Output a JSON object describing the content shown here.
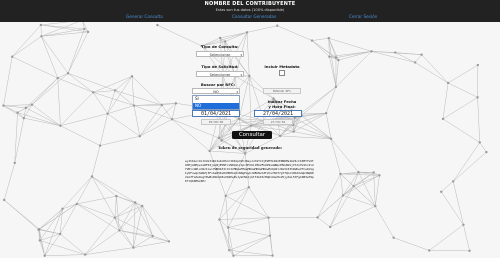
{
  "header": {
    "title": "NOMBRE DEL CONTRIBUYENTE",
    "subtitle": "Estas son tus datos (100% disponible)"
  },
  "nav": {
    "items": [
      {
        "label": "Generar Consulta"
      },
      {
        "label": "Consultar Generadas"
      },
      {
        "label": "Cerrar Sesión"
      }
    ]
  },
  "form": {
    "tipo_consulta": {
      "label": "Tipo de Consulta:",
      "value": "Seleccionar"
    },
    "tipo_solicitud": {
      "label": "Tipo de Solicitud:",
      "value": "Seleccionar"
    },
    "incluir_metadata": {
      "label": "Incluir Metadata"
    },
    "buscar_rfc": {
      "label": "Buscar por RFC:",
      "value": "NO",
      "options": [
        "SI",
        "NO"
      ]
    },
    "rfc_hint": "BUSCAR RFC",
    "fecha_inicial": {
      "value": "01/04/2021",
      "time": "00:00:00"
    },
    "fecha_final": {
      "label_line1": "Indicar Fecha",
      "label_line2": "y Hora Final:",
      "value": "27/04/2021",
      "time": "23:59:59"
    },
    "submit_label": "Consultar"
  },
  "token": {
    "title": "Token de seguridad generado:",
    "value": "eyJhbGciOiJIUzI1NiIsInR5cCI6IkpXVCJ9eyJuYmYiOjE2MTk1NzE0NDMsImV4cCI6MTYxOTU3MjA0MywiaWF0IjoxNjE5NTcxNDQzLCJpc3MiOiJMb2FkU29saWNpdHVkRGVjYXJnYU1hc2l2YVRlcmNlcm9zIiwiYWN0b3IiOiIzMDAwMTAwMDAwMDUwMDAwMzQxNiJ9oVkI3hbWbwVfCwIkSgIyOFxwqzhUWZj5FvSe05bvRnM6HkzhnN0gPaykJZ8bNvhZTzhs7DmT7gYfQnz1XKd2vWp3RqRK2LmfTaXo9ugYPwBx0bhmC8sVQ2EePuJyWrN1AjGtf4kI0cMqDzUanHsVOjyXoL5tFgiRB3wT9pK7lQb6MSx0Ec"
  }
}
